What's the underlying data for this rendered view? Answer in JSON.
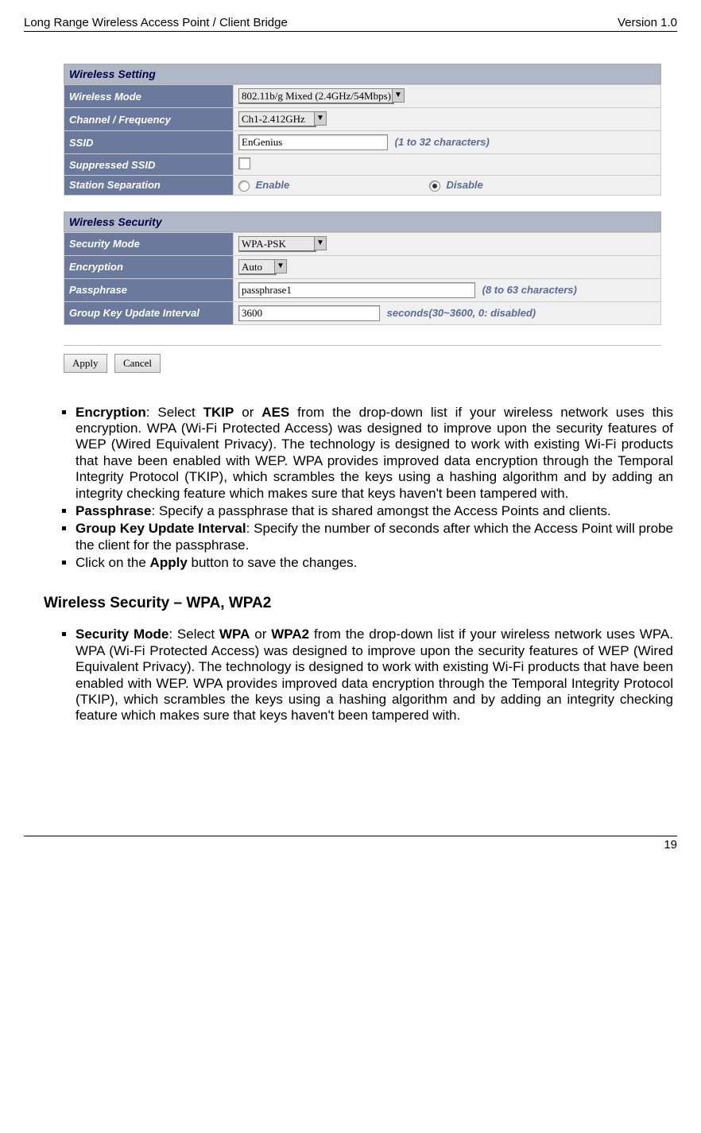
{
  "header": {
    "left": "Long Range Wireless Access Point / Client Bridge",
    "right": "Version 1.0"
  },
  "wireless_setting": {
    "title": "Wireless Setting",
    "rows": {
      "wireless_mode": {
        "label": "Wireless Mode",
        "value": "802.11b/g Mixed (2.4GHz/54Mbps)"
      },
      "channel": {
        "label": "Channel / Frequency",
        "value": "Ch1-2.412GHz"
      },
      "ssid": {
        "label": "SSID",
        "value": "EnGenius",
        "hint": "(1 to 32 characters)"
      },
      "suppressed": {
        "label": "Suppressed SSID"
      },
      "station_sep": {
        "label": "Station Separation",
        "enable": "Enable",
        "disable": "Disable"
      }
    }
  },
  "wireless_security": {
    "title": "Wireless Security",
    "rows": {
      "mode": {
        "label": "Security Mode",
        "value": "WPA-PSK"
      },
      "encryption": {
        "label": "Encryption",
        "value": "Auto"
      },
      "passphrase": {
        "label": "Passphrase",
        "value": "passphrase1",
        "hint": "(8 to 63 characters)"
      },
      "group_key": {
        "label": "Group Key Update Interval",
        "value": "3600",
        "hint": "seconds(30~3600, 0: disabled)"
      }
    }
  },
  "buttons": {
    "apply": "Apply",
    "cancel": "Cancel"
  },
  "body": {
    "bullets1": {
      "b1_strong": "Encryption",
      "b1_rest": ": Select ",
      "b1_tkip": "TKIP",
      "b1_or": " or ",
      "b1_aes": "AES",
      "b1_tail": " from the drop-down list if your wireless network uses this encryption. WPA (Wi-Fi Protected Access) was designed to improve upon the security features of WEP (Wired Equivalent Privacy). The technology is designed to work with existing Wi-Fi products that have been enabled with WEP. WPA provides improved data encryption through the Temporal Integrity Protocol (TKIP), which scrambles the keys using a hashing algorithm and by adding an integrity checking feature which makes sure that keys haven't been tampered with.",
      "b2_strong": "Passphrase",
      "b2_rest": ": Specify a passphrase that is shared amongst the Access Points and clients.",
      "b3_strong": "Group Key Update Interval",
      "b3_rest": ": Specify the number of seconds after which the Access Point will probe the client for the passphrase.",
      "b4_pre": "Click on the ",
      "b4_strong": "Apply",
      "b4_rest": " button to save the changes."
    },
    "heading2": "Wireless Security – WPA, WPA2",
    "bullets2": {
      "b1_strong": "Security Mode",
      "b1_rest": ": Select ",
      "b1_wpa": "WPA",
      "b1_or": " or ",
      "b1_wpa2": "WPA2",
      "b1_tail": " from the drop-down list if your wireless network uses WPA. WPA (Wi-Fi Protected Access) was designed to improve upon the security features of WEP (Wired Equivalent Privacy). The technology is designed to work with existing Wi-Fi products that have been enabled with WEP. WPA provides improved data encryption through the Temporal Integrity Protocol (TKIP), which scrambles the keys using a hashing algorithm and by adding an integrity checking feature which makes sure that keys haven't been tampered with."
    }
  },
  "footer": {
    "page": "19"
  }
}
